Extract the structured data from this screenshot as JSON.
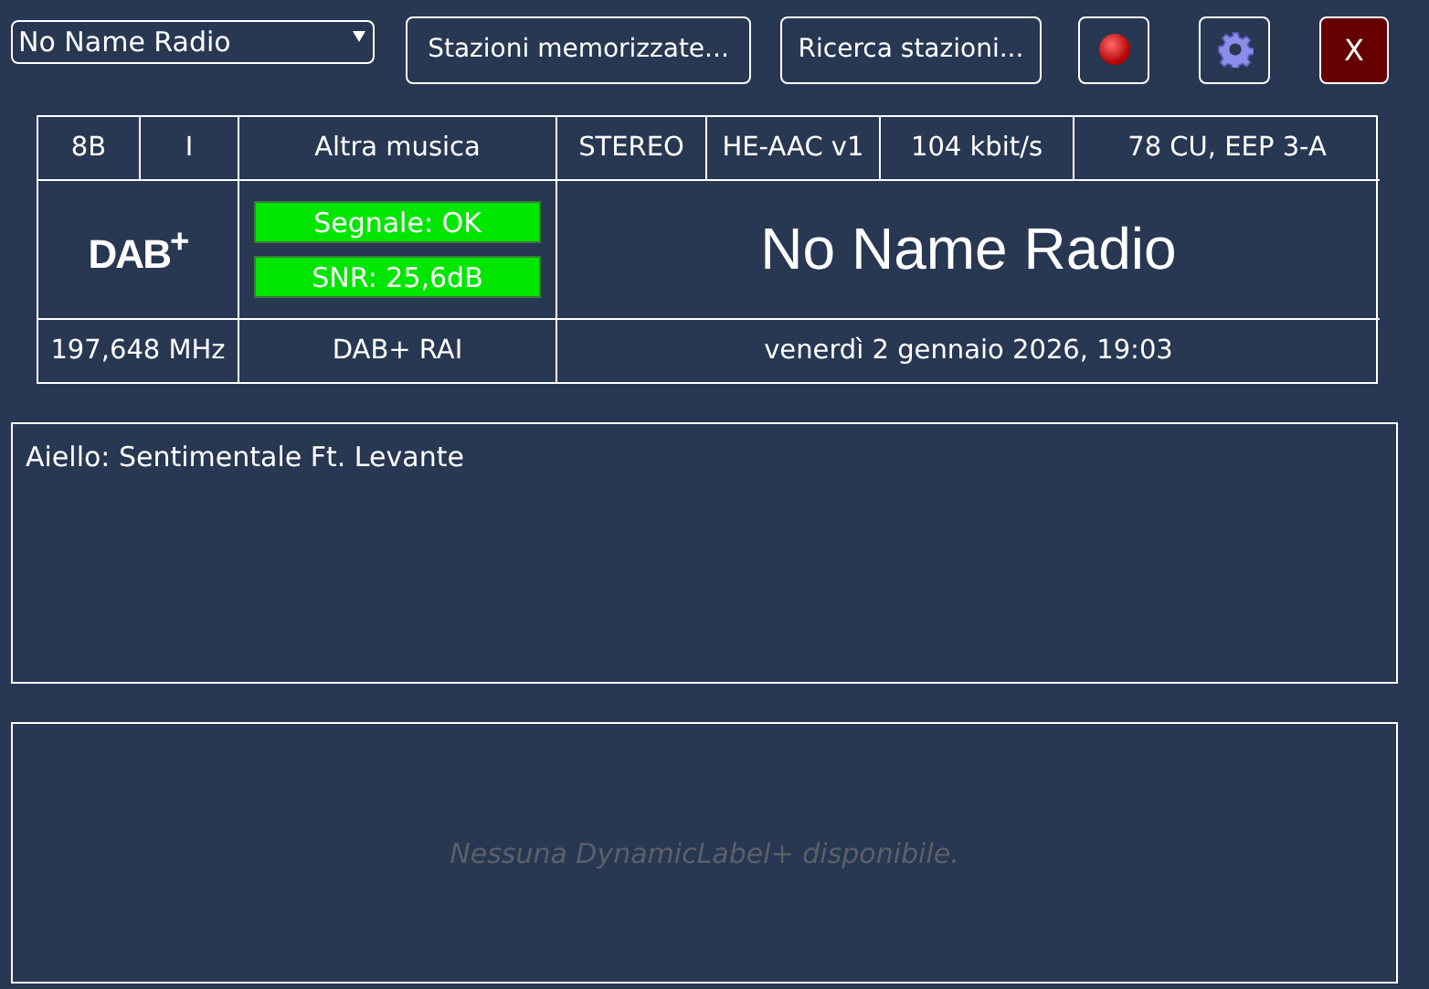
{
  "toolbar": {
    "station_select": "No Name Radio",
    "buttons": [
      "Stazioni memorizzate...",
      "Ricerca stazioni..."
    ],
    "close": "X"
  },
  "info": {
    "channel": "8B",
    "column_2": "I",
    "genre": "Altra musica",
    "mode": "STEREO",
    "codec": "HE-AAC v1",
    "bitrate": "104 kbit/s",
    "protection": "78 CU, EEP 3-A",
    "logo": "DAB$^{+}$",
    "signal": "Segnale: OK",
    "snr": "SNR: 25,6dB",
    "station": "No Name Radio",
    "frequency": "197,648 MHz",
    "ensemble": "DAB+ RAI",
    "datetime": "venerdì 2 gennaio 2026, 19:03"
  },
  "radiotext": "Aiello: Sentimentale Ft. Levante",
  "dl_plus": {
    "placeholder": "Nessuna DynamicLabel+ disponibile."
  }
}
